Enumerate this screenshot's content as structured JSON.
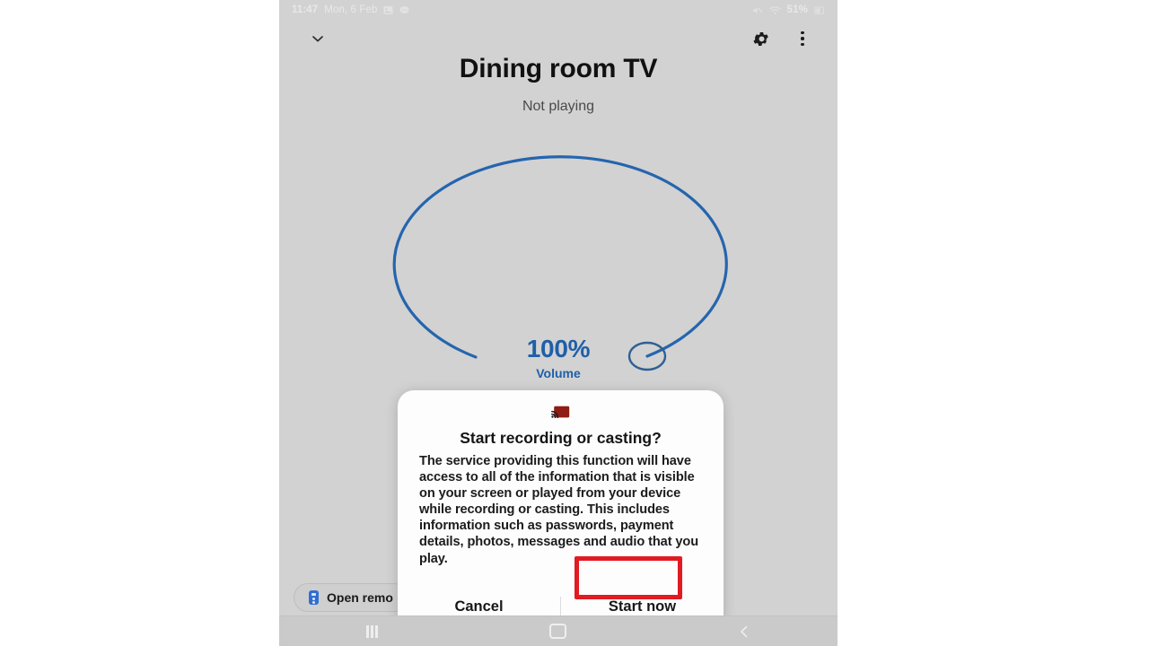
{
  "status_bar": {
    "time": "11:47",
    "date": "Mon, 6 Feb",
    "notification_icons": [
      "image-icon",
      "chat-bubble-icon"
    ],
    "mute_icon": "mute-icon",
    "wifi_icon": "wifi-icon",
    "battery_percent": "51%",
    "battery_icon": "battery-icon"
  },
  "app_bar": {
    "collapse_icon": "chevron-down-icon",
    "settings_icon": "gear-icon",
    "overflow_icon": "more-vertical-icon"
  },
  "device": {
    "title": "Dining room TV",
    "playback_state": "Not playing"
  },
  "volume": {
    "value_label": "100%",
    "caption": "Volume",
    "percent": 100,
    "accent_color": "#1f5fa8"
  },
  "remote_chip": {
    "label": "Open remo",
    "icon": "tv-remote-icon"
  },
  "dialog": {
    "icon": "screen-cast-icon",
    "icon_color": "#8f1d15",
    "title": "Start recording or casting?",
    "body": "The service providing this function will have access to all of the information that is visible on your screen or played from your device while recording or casting. This includes information such as passwords, payment details, photos, messages and audio that you play.",
    "cancel_label": "Cancel",
    "confirm_label": "Start now",
    "highlight_color": "#e01b22"
  },
  "nav_bar": {
    "recents_icon": "recents-icon",
    "home_icon": "home-icon",
    "back_icon": "back-icon"
  }
}
